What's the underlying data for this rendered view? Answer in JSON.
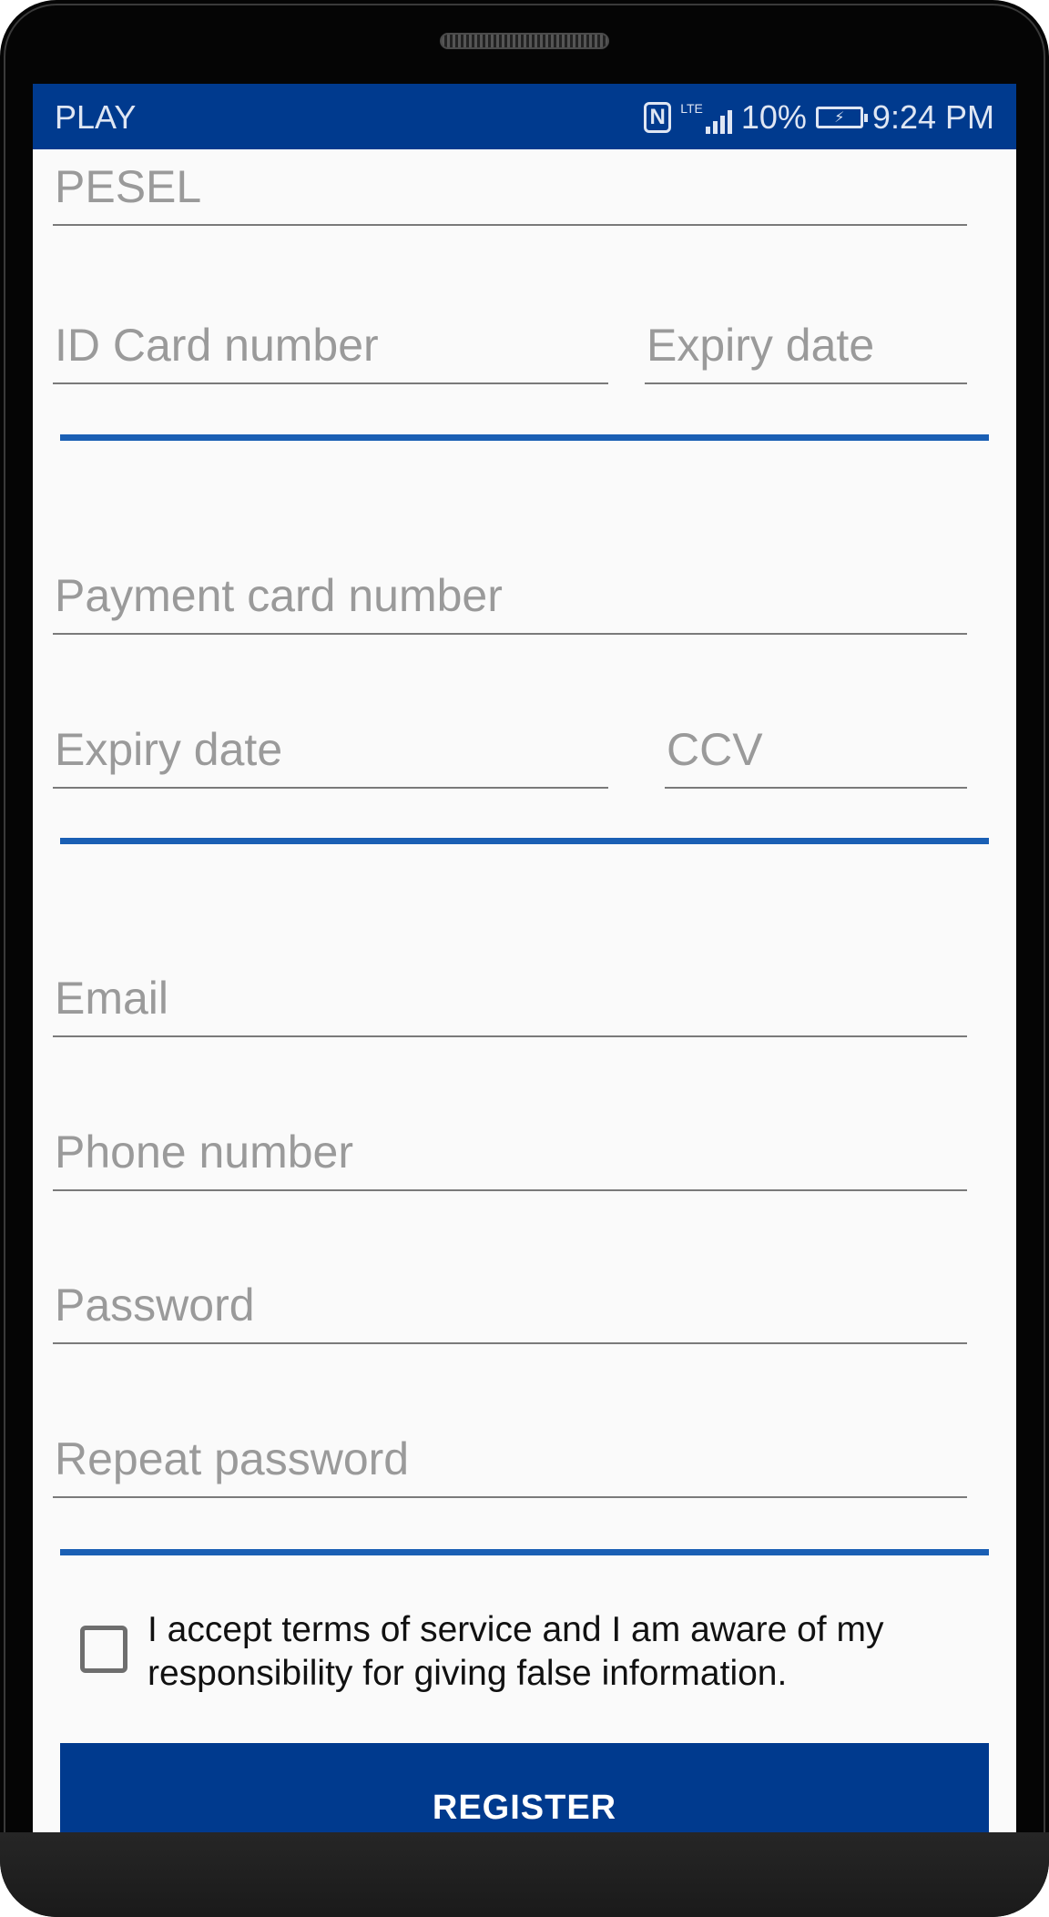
{
  "status_bar": {
    "carrier": "PLAY",
    "nfc_icon": "nfc-icon",
    "network_label": "LTE",
    "battery_percent": "10%",
    "time": "9:24 PM"
  },
  "form": {
    "identity": {
      "pesel_label": "PESEL",
      "id_card_label": "ID Card number",
      "id_expiry_label": "Expiry date"
    },
    "payment": {
      "card_number_label": "Payment card number",
      "card_expiry_label": "Expiry date",
      "ccv_label": "CCV"
    },
    "account": {
      "email_label": "Email",
      "phone_label": "Phone number",
      "password_label": "Password",
      "repeat_password_label": "Repeat password"
    },
    "terms_text": "I accept terms of service and I am aware of my responsibility for giving false information.",
    "terms_checked": false,
    "register_label": "REGISTER"
  },
  "colors": {
    "status_bar": "#003a8e",
    "accent_divider": "#1a5fb4",
    "button": "#003a8e",
    "label": "#9a9a9a"
  }
}
